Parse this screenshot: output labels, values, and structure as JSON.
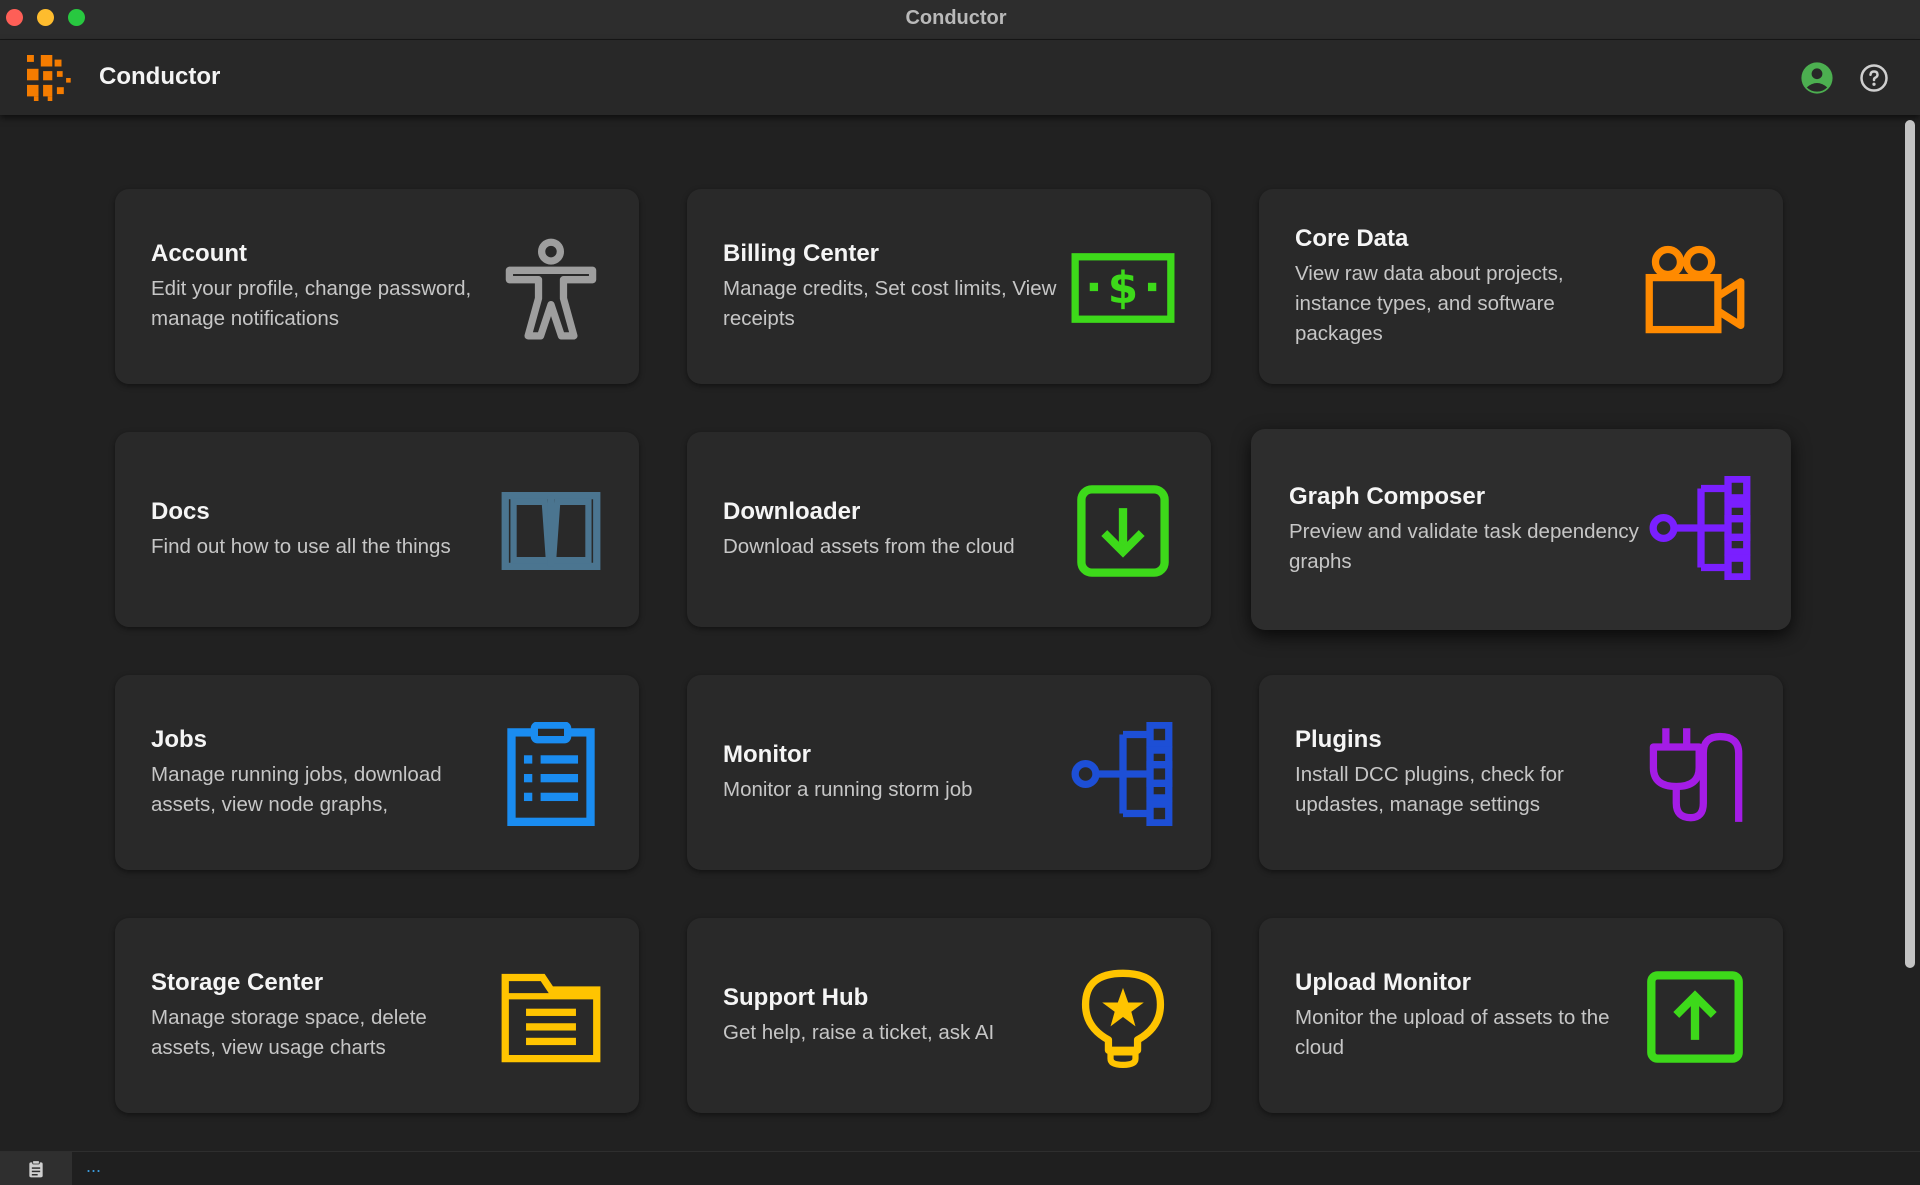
{
  "window": {
    "title": "Conductor"
  },
  "appbar": {
    "title": "Conductor"
  },
  "colors": {
    "brand": "#f57c00",
    "account_icon": "#4caf50",
    "help_icon": "#cfcfcf"
  },
  "cards": [
    {
      "title": "Account",
      "description": "Edit your profile, change password, manage notifications",
      "icon": "accessibility-icon",
      "color": "#9e9e9e"
    },
    {
      "title": "Billing Center",
      "description": "Manage credits, Set cost limits, View receipts",
      "icon": "dollar-bill-icon",
      "color": "#3dd91a"
    },
    {
      "title": "Core Data",
      "description": "View raw data about projects, instance types, and software packages",
      "icon": "video-camera-icon",
      "color": "#ff8a00"
    },
    {
      "title": "Docs",
      "description": "Find out how to use all the things",
      "icon": "book-icon",
      "color": "#4b7590"
    },
    {
      "title": "Downloader",
      "description": "Download assets from the cloud",
      "icon": "download-icon",
      "color": "#3dd91a"
    },
    {
      "title": "Graph Composer",
      "description": "Preview and validate task dependency graphs",
      "icon": "tree-graph-icon",
      "color": "#7a1fff"
    },
    {
      "title": "Jobs",
      "description": "Manage running jobs, download assets, view node graphs,",
      "icon": "clipboard-list-icon",
      "color": "#1a8cf0"
    },
    {
      "title": "Monitor",
      "description": "Monitor a running storm job",
      "icon": "tree-graph-icon",
      "color": "#1d4fd6"
    },
    {
      "title": "Plugins",
      "description": "Install DCC plugins, check for updastes, manage settings",
      "icon": "plug-icon",
      "color": "#a41ce6"
    },
    {
      "title": "Storage Center",
      "description": "Manage storage space, delete assets, view usage charts",
      "icon": "folder-icon",
      "color": "#ffc400"
    },
    {
      "title": "Support Hub",
      "description": "Get help, raise a ticket, ask AI",
      "icon": "lightbulb-icon",
      "color": "#ffc400"
    },
    {
      "title": "Upload Monitor",
      "description": "Monitor the upload of assets to the cloud",
      "icon": "upload-icon",
      "color": "#3dd91a"
    }
  ],
  "statusbar": {
    "text": "..."
  }
}
